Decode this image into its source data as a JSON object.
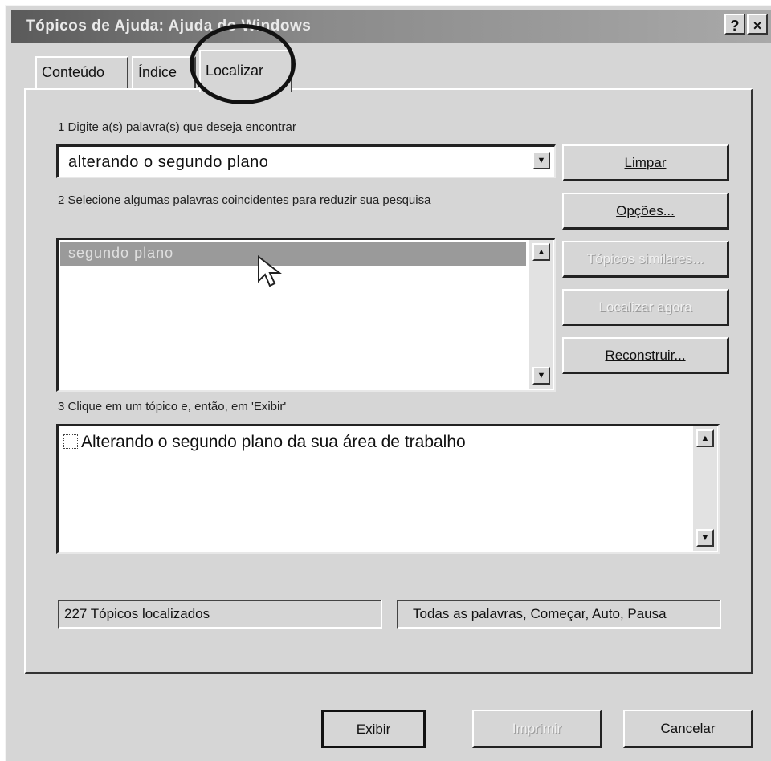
{
  "window": {
    "title": "Tópicos de Ajuda: Ajuda do Windows",
    "help_button": "?",
    "close_button": "×"
  },
  "tabs": [
    {
      "label": "Conteúdo"
    },
    {
      "label": "Índice"
    },
    {
      "label": "Localizar"
    }
  ],
  "step1": {
    "label": "1 Digite a(s) palavra(s) que deseja encontrar",
    "value": "alterando o segundo plano"
  },
  "step2": {
    "label": "2 Selecione algumas palavras coincidentes para reduzir sua pesquisa",
    "items": [
      "segundo plano"
    ]
  },
  "step3": {
    "label": "3 Clique em um tópico e, então, em 'Exibir'",
    "items": [
      "Alterando o segundo plano da sua área de trabalho"
    ]
  },
  "side_buttons": {
    "clear": "Limpar",
    "options": "Opções...",
    "similar": "Tópicos similares...",
    "find_similar": "Localizar agora",
    "rebuild": "Reconstruir..."
  },
  "status": {
    "count": "227 Tópicos localizados",
    "mode": "Todas as palavras, Começar, Auto, Pausa"
  },
  "bottom_buttons": {
    "display": "Exibir",
    "print": "Imprimir",
    "cancel": "Cancelar"
  }
}
